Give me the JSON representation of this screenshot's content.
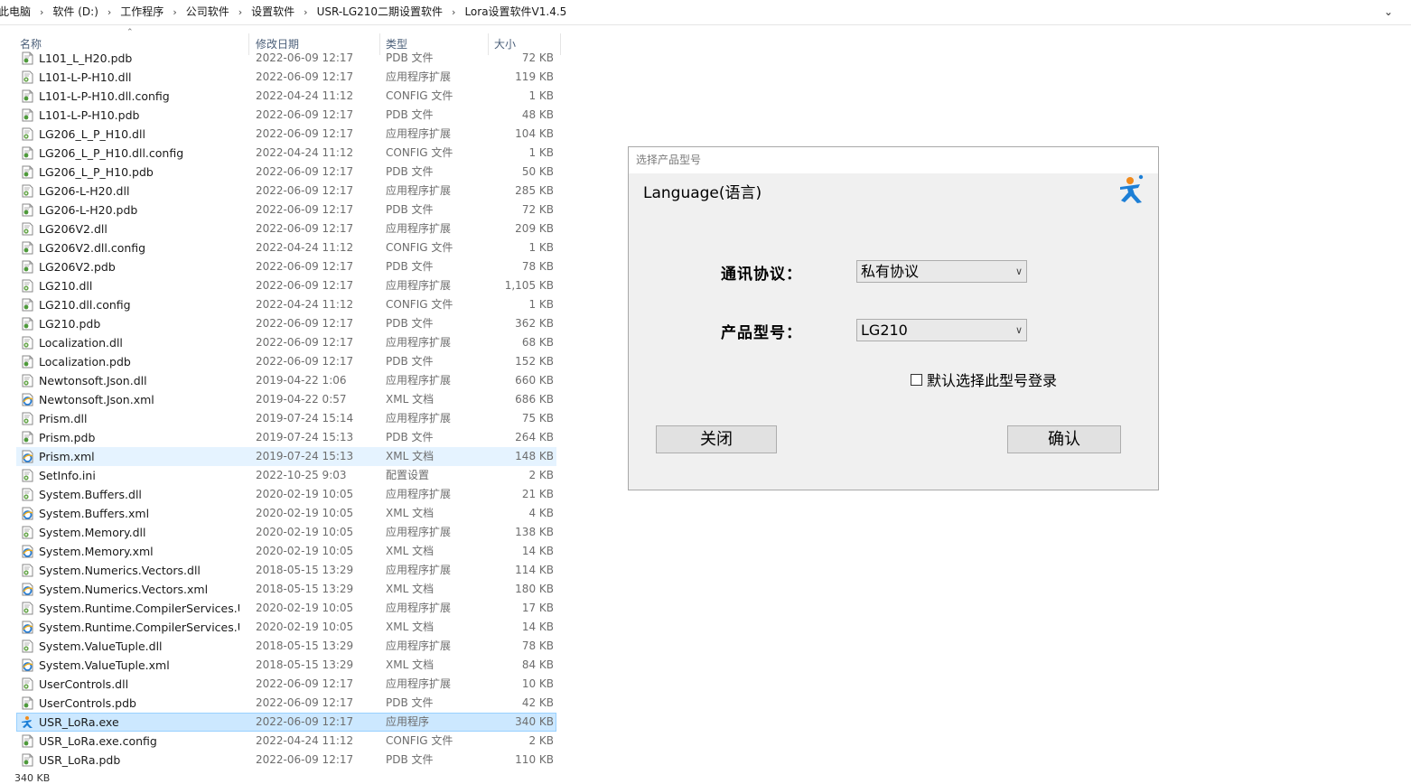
{
  "breadcrumb": [
    "此电脑",
    "软件 (D:)",
    "工作程序",
    "公司软件",
    "设置软件",
    "USR-LG210二期设置软件",
    "Lora设置软件V1.4.5"
  ],
  "columns": {
    "name": "名称",
    "date": "修改日期",
    "type": "类型",
    "size": "大小"
  },
  "files": [
    {
      "name": "L101_L_H20.pdb",
      "date": "2022-06-09 12:17",
      "type": "PDB 文件",
      "size": "72 KB",
      "icon": "file-icon"
    },
    {
      "name": "L101-L-P-H10.dll",
      "date": "2022-06-09 12:17",
      "type": "应用程序扩展",
      "size": "119 KB",
      "icon": "dll-icon"
    },
    {
      "name": "L101-L-P-H10.dll.config",
      "date": "2022-04-24 11:12",
      "type": "CONFIG 文件",
      "size": "1 KB",
      "icon": "file-icon"
    },
    {
      "name": "L101-L-P-H10.pdb",
      "date": "2022-06-09 12:17",
      "type": "PDB 文件",
      "size": "48 KB",
      "icon": "file-icon"
    },
    {
      "name": "LG206_L_P_H10.dll",
      "date": "2022-06-09 12:17",
      "type": "应用程序扩展",
      "size": "104 KB",
      "icon": "dll-icon"
    },
    {
      "name": "LG206_L_P_H10.dll.config",
      "date": "2022-04-24 11:12",
      "type": "CONFIG 文件",
      "size": "1 KB",
      "icon": "file-icon"
    },
    {
      "name": "LG206_L_P_H10.pdb",
      "date": "2022-06-09 12:17",
      "type": "PDB 文件",
      "size": "50 KB",
      "icon": "file-icon"
    },
    {
      "name": "LG206-L-H20.dll",
      "date": "2022-06-09 12:17",
      "type": "应用程序扩展",
      "size": "285 KB",
      "icon": "dll-icon"
    },
    {
      "name": "LG206-L-H20.pdb",
      "date": "2022-06-09 12:17",
      "type": "PDB 文件",
      "size": "72 KB",
      "icon": "file-icon"
    },
    {
      "name": "LG206V2.dll",
      "date": "2022-06-09 12:17",
      "type": "应用程序扩展",
      "size": "209 KB",
      "icon": "dll-icon"
    },
    {
      "name": "LG206V2.dll.config",
      "date": "2022-04-24 11:12",
      "type": "CONFIG 文件",
      "size": "1 KB",
      "icon": "file-icon"
    },
    {
      "name": "LG206V2.pdb",
      "date": "2022-06-09 12:17",
      "type": "PDB 文件",
      "size": "78 KB",
      "icon": "file-icon"
    },
    {
      "name": "LG210.dll",
      "date": "2022-06-09 12:17",
      "type": "应用程序扩展",
      "size": "1,105 KB",
      "icon": "dll-icon"
    },
    {
      "name": "LG210.dll.config",
      "date": "2022-04-24 11:12",
      "type": "CONFIG 文件",
      "size": "1 KB",
      "icon": "file-icon"
    },
    {
      "name": "LG210.pdb",
      "date": "2022-06-09 12:17",
      "type": "PDB 文件",
      "size": "362 KB",
      "icon": "file-icon"
    },
    {
      "name": "Localization.dll",
      "date": "2022-06-09 12:17",
      "type": "应用程序扩展",
      "size": "68 KB",
      "icon": "dll-icon"
    },
    {
      "name": "Localization.pdb",
      "date": "2022-06-09 12:17",
      "type": "PDB 文件",
      "size": "152 KB",
      "icon": "file-icon"
    },
    {
      "name": "Newtonsoft.Json.dll",
      "date": "2019-04-22 1:06",
      "type": "应用程序扩展",
      "size": "660 KB",
      "icon": "dll-icon"
    },
    {
      "name": "Newtonsoft.Json.xml",
      "date": "2019-04-22 0:57",
      "type": "XML 文档",
      "size": "686 KB",
      "icon": "xml-icon"
    },
    {
      "name": "Prism.dll",
      "date": "2019-07-24 15:14",
      "type": "应用程序扩展",
      "size": "75 KB",
      "icon": "dll-icon"
    },
    {
      "name": "Prism.pdb",
      "date": "2019-07-24 15:13",
      "type": "PDB 文件",
      "size": "264 KB",
      "icon": "file-icon"
    },
    {
      "name": "Prism.xml",
      "date": "2019-07-24 15:13",
      "type": "XML 文档",
      "size": "148 KB",
      "icon": "xml-icon"
    },
    {
      "name": "SetInfo.ini",
      "date": "2022-10-25 9:03",
      "type": "配置设置",
      "size": "2 KB",
      "icon": "ini-icon"
    },
    {
      "name": "System.Buffers.dll",
      "date": "2020-02-19 10:05",
      "type": "应用程序扩展",
      "size": "21 KB",
      "icon": "dll-icon"
    },
    {
      "name": "System.Buffers.xml",
      "date": "2020-02-19 10:05",
      "type": "XML 文档",
      "size": "4 KB",
      "icon": "xml-icon"
    },
    {
      "name": "System.Memory.dll",
      "date": "2020-02-19 10:05",
      "type": "应用程序扩展",
      "size": "138 KB",
      "icon": "dll-icon"
    },
    {
      "name": "System.Memory.xml",
      "date": "2020-02-19 10:05",
      "type": "XML 文档",
      "size": "14 KB",
      "icon": "xml-icon"
    },
    {
      "name": "System.Numerics.Vectors.dll",
      "date": "2018-05-15 13:29",
      "type": "应用程序扩展",
      "size": "114 KB",
      "icon": "dll-icon"
    },
    {
      "name": "System.Numerics.Vectors.xml",
      "date": "2018-05-15 13:29",
      "type": "XML 文档",
      "size": "180 KB",
      "icon": "xml-icon"
    },
    {
      "name": "System.Runtime.CompilerServices.Un...",
      "date": "2020-02-19 10:05",
      "type": "应用程序扩展",
      "size": "17 KB",
      "icon": "dll-icon"
    },
    {
      "name": "System.Runtime.CompilerServices.Un...",
      "date": "2020-02-19 10:05",
      "type": "XML 文档",
      "size": "14 KB",
      "icon": "xml-icon"
    },
    {
      "name": "System.ValueTuple.dll",
      "date": "2018-05-15 13:29",
      "type": "应用程序扩展",
      "size": "78 KB",
      "icon": "dll-icon"
    },
    {
      "name": "System.ValueTuple.xml",
      "date": "2018-05-15 13:29",
      "type": "XML 文档",
      "size": "84 KB",
      "icon": "xml-icon"
    },
    {
      "name": "UserControls.dll",
      "date": "2022-06-09 12:17",
      "type": "应用程序扩展",
      "size": "10 KB",
      "icon": "dll-icon"
    },
    {
      "name": "UserControls.pdb",
      "date": "2022-06-09 12:17",
      "type": "PDB 文件",
      "size": "42 KB",
      "icon": "file-icon"
    },
    {
      "name": "USR_LoRa.exe",
      "date": "2022-06-09 12:17",
      "type": "应用程序",
      "size": "340 KB",
      "icon": "app-icon",
      "selected": true
    },
    {
      "name": "USR_LoRa.exe.config",
      "date": "2022-04-24 11:12",
      "type": "CONFIG 文件",
      "size": "2 KB",
      "icon": "file-icon"
    },
    {
      "name": "USR_LoRa.pdb",
      "date": "2022-06-09 12:17",
      "type": "PDB 文件",
      "size": "110 KB",
      "icon": "file-icon"
    }
  ],
  "hover_row": "Prism.xml",
  "status": {
    "selection_size": "340 KB"
  },
  "dialog": {
    "title": "选择产品型号",
    "language_link": "Language(语言)",
    "protocol_label": "通讯协议：",
    "protocol_value": "私有协议",
    "model_label": "产品型号：",
    "model_value": "LG210",
    "remember_label": "默认选择此型号登录",
    "remember_checked": false,
    "close_button": "关闭",
    "confirm_button": "确认",
    "logo_icon": "usr-logo-icon"
  },
  "colors": {
    "selection": "#cce8ff",
    "hover": "#e5f3ff",
    "logo_blue": "#1d7fd6",
    "logo_orange": "#f08a1c"
  }
}
